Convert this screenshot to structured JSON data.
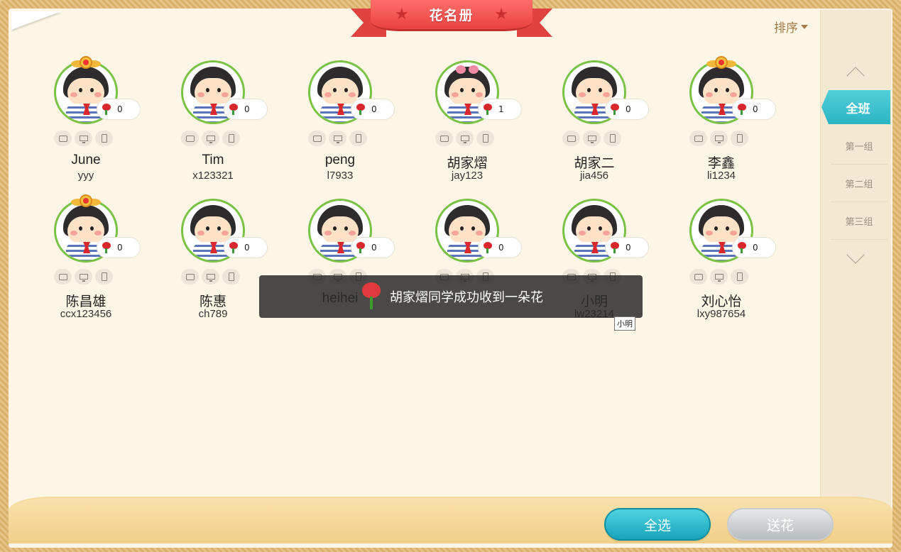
{
  "header": {
    "title": "花名册",
    "sort_label": "排序"
  },
  "students": [
    {
      "name": "June",
      "id": "yyy",
      "flowers": "0",
      "avatar": "boy",
      "badge": true
    },
    {
      "name": "Tim",
      "id": "x123321",
      "flowers": "0",
      "avatar": "boy",
      "badge": false
    },
    {
      "name": "peng",
      "id": "l7933",
      "flowers": "0",
      "avatar": "boy",
      "badge": false
    },
    {
      "name": "胡家熠",
      "id": "jay123",
      "flowers": "1",
      "avatar": "girl",
      "badge": false
    },
    {
      "name": "胡家二",
      "id": "jia456",
      "flowers": "0",
      "avatar": "boy",
      "badge": false
    },
    {
      "name": "李鑫",
      "id": "li1234",
      "flowers": "0",
      "avatar": "boy",
      "badge": true
    },
    {
      "name": "陈昌雄",
      "id": "ccx123456",
      "flowers": "0",
      "avatar": "boy",
      "badge": true
    },
    {
      "name": "陈惠",
      "id": "ch789",
      "flowers": "0",
      "avatar": "boy",
      "badge": false
    },
    {
      "name": "heihei",
      "id": "",
      "flowers": "0",
      "avatar": "boy",
      "badge": false
    },
    {
      "name": "",
      "id": "",
      "flowers": "0",
      "avatar": "boy",
      "badge": false
    },
    {
      "name": "小明",
      "id": "lw23214",
      "flowers": "0",
      "avatar": "boy",
      "badge": false
    },
    {
      "name": "刘心怡",
      "id": "lxy987654",
      "flowers": "0",
      "avatar": "boy",
      "badge": false
    }
  ],
  "sidebar": {
    "active_tab": "全班",
    "groups": [
      "第一组",
      "第二组",
      "第三组"
    ]
  },
  "toast": {
    "message": "胡家熠同学成功收到一朵花"
  },
  "tooltip": {
    "text": "小明"
  },
  "footer": {
    "select_all_label": "全选",
    "send_flower_label": "送花"
  },
  "colors": {
    "accent_teal": "#2bb4c4",
    "ribbon_red": "#e8433f",
    "avatar_ring_green": "#79c244",
    "panel_bg": "#fdf6e6"
  }
}
